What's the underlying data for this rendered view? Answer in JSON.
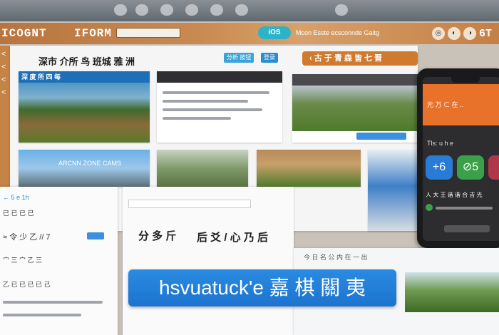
{
  "topbar": {
    "pills": 7
  },
  "header": {
    "logo": "ICOGNT",
    "logo2": "IFORM",
    "search_value": "",
    "nav_pill": "iOS",
    "nav_text": "Mcon Esste ecsconnde Gaitg",
    "right_label": "6T",
    "right_icons": [
      "circle-1-icon",
      "circle-2-icon",
      "circle-3-icon"
    ]
  },
  "side": {
    "glyphs": [
      "<",
      "<",
      "<",
      "<"
    ]
  },
  "main": {
    "title": "深市 介所 鸟 班城 雅 洲",
    "buttons": [
      "分析 按钮",
      "登录"
    ],
    "orange_banner": "‹  古 于 青 森 皆 七 晋",
    "cards": [
      {
        "title": "深 度  所  四  每",
        "color": "#1d6fb8"
      },
      {
        "title": "",
        "color": "#2f2f33"
      },
      {
        "title": "",
        "color": "#4a4a4f"
      }
    ],
    "card_lines": [
      "ARCNN ZONE CAMS"
    ]
  },
  "phone": {
    "header_text": "元 万 ⊂ 在 ..",
    "tiles": [
      "+6",
      "⊘5",
      ""
    ],
    "caption": "Tls: u h e",
    "caption2": "人 大 王 谐 谐 合 吉 光",
    "bottom_label": ""
  },
  "bottom_left": {
    "lines": [
      "← 5 e 1h",
      "已 已 已 已",
      "≈ 令 少 乙 // 7",
      "宀 三 宀 乙 三",
      "乙 已 已 已 已 己"
    ]
  },
  "bottom_mid": {
    "big_text_1": "分 多 斤",
    "big_text_2": "后 爻 / 心 乃 后",
    "hero": "hsvuatuck'e 嘉 棋 關 夷"
  },
  "bottom_right": {
    "label": "今 日 名 公 内 在 一 出"
  }
}
